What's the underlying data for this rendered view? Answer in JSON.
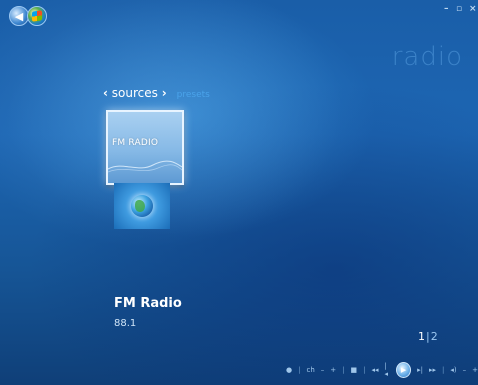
{
  "window": {
    "title": "radio",
    "controls": {
      "minimize": "–",
      "restore": "▫",
      "close": "×"
    }
  },
  "nav": {
    "back_icon": "back-arrow-icon",
    "start_icon": "windows-media-center-logo-icon"
  },
  "tabs": [
    {
      "label": "sources",
      "active": true
    },
    {
      "label": "presets",
      "active": false
    }
  ],
  "tiles": [
    {
      "label": "FM RADIO",
      "selected": true
    }
  ],
  "selected_item": {
    "name": "FM Radio",
    "frequency": "88.1"
  },
  "pager": {
    "current": "1",
    "other": "2"
  },
  "transport": {
    "items": [
      "●",
      "|",
      "ch",
      "–",
      "+",
      "|",
      "■",
      "|",
      "◂◂",
      "|◂",
      "▶",
      "▸|",
      "▸▸",
      "|",
      "◂)",
      "–",
      "+"
    ]
  },
  "colors": {
    "background": "#1d66b3",
    "title": "#3b82c8",
    "tab_inactive": "#4aa3ea",
    "tile": "#86b9e6"
  }
}
